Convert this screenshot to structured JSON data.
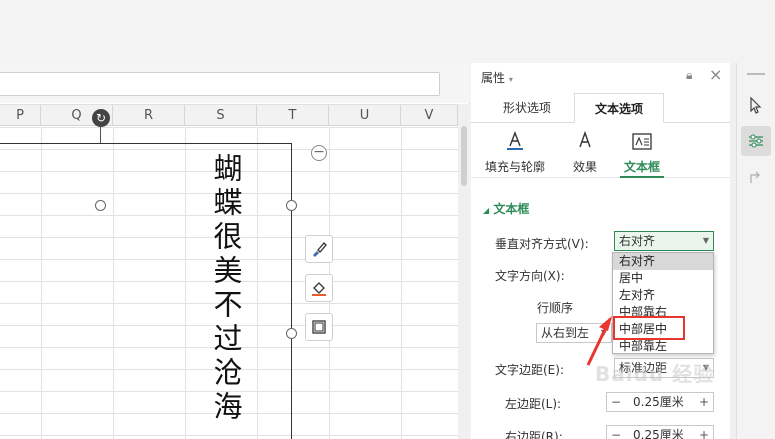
{
  "sheet": {
    "columns": [
      "P",
      "Q",
      "R",
      "S",
      "T",
      "U",
      "V"
    ],
    "textbox_lines": [
      "蝴蝶很美",
      "不过沧海"
    ]
  },
  "panel": {
    "title": "属性",
    "tabs": [
      "形状选项",
      "文本选项"
    ],
    "active_tab": "文本选项",
    "subtabs": [
      "填充与轮廓",
      "效果",
      "文本框"
    ],
    "active_subtab": "文本框",
    "section": "文本框",
    "vertical_align_label": "垂直对齐方式(V):",
    "vertical_align_value": "右对齐",
    "text_direction_label": "文字方向(X):",
    "row_order_label": "行顺序",
    "row_order_value": "从右到左",
    "text_margin_label": "文字边距(E):",
    "text_margin_value": "标准边距",
    "left_margin_label": "左边距(L):",
    "left_margin_value": "0.25厘米",
    "right_margin_label": "右边距(R):",
    "right_margin_value": "0.25厘米",
    "dropdown_options": [
      "右对齐",
      "居中",
      "左对齐",
      "中部靠右",
      "中部居中",
      "中部靠左"
    ],
    "selected_option": "右对齐",
    "highlighted_option": "中部居中"
  },
  "watermark": "Baidu 经验",
  "colors": {
    "accent": "#2e8b57",
    "highlight_box": "#e8352f"
  }
}
